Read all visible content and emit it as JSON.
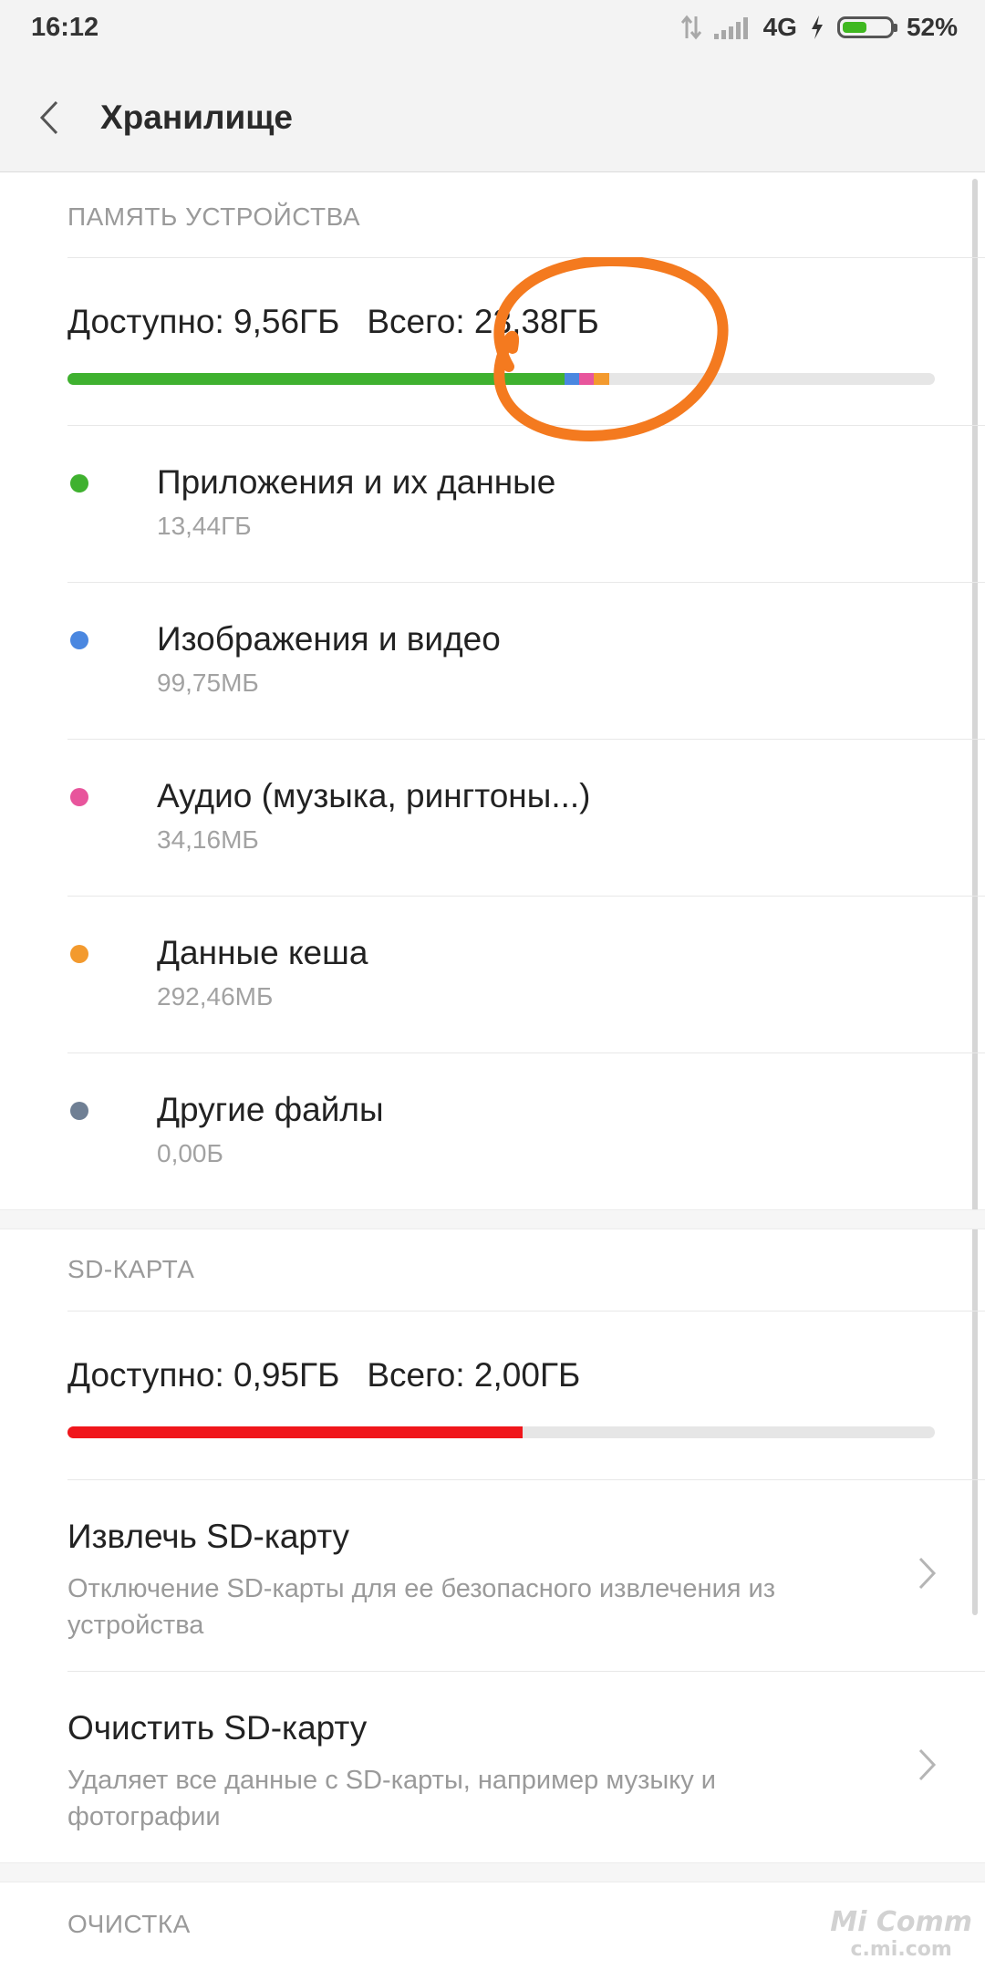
{
  "status_bar": {
    "time": "16:12",
    "network": "4G",
    "battery": "52%",
    "battery_level": 0.52
  },
  "app_bar": {
    "title": "Хранилище"
  },
  "device_memory": {
    "section_label": "ПАМЯТЬ УСТРОЙСТВА",
    "available": "Доступно: 9,56ГБ",
    "total": "Всего: 23,38ГБ",
    "usage_bar": [
      {
        "category": "apps",
        "fraction": 0.573,
        "color": "#3fb12f"
      },
      {
        "category": "images",
        "fraction": 0.017,
        "color": "#4a87e0"
      },
      {
        "category": "audio",
        "fraction": 0.017,
        "color": "#e8559c"
      },
      {
        "category": "cache",
        "fraction": 0.018,
        "color": "#f39a2e"
      }
    ],
    "categories": [
      {
        "name": "Приложения и их данные",
        "size": "13,44ГБ",
        "color": "#3fb12f"
      },
      {
        "name": "Изображения и видео",
        "size": "99,75МБ",
        "color": "#4a87e0"
      },
      {
        "name": "Аудио (музыка, рингтоны...)",
        "size": "34,16МБ",
        "color": "#e8559c"
      },
      {
        "name": "Данные кеша",
        "size": "292,46МБ",
        "color": "#f39a2e"
      },
      {
        "name": "Другие файлы",
        "size": "0,00Б",
        "color": "#6f7f94"
      }
    ]
  },
  "sd_card": {
    "section_label": "SD-КАРТА",
    "available": "Доступно: 0,95ГБ",
    "total": "Всего: 2,00ГБ",
    "used_fraction": 0.525,
    "bar_color": "#f0161b",
    "actions": [
      {
        "title": "Извлечь SD-карту",
        "description": "Отключение SD-карты для ее безопасного извлечения из устройства"
      },
      {
        "title": "Очистить SD-карту",
        "description": "Удаляет все данные с SD-карты, например музыку и фотографии"
      }
    ]
  },
  "cleanup": {
    "section_label": "ОЧИСТКА"
  },
  "watermark": {
    "line1": "Mi Comm",
    "line2": "c.mi.com"
  },
  "annotation_color": "#f47a1f"
}
